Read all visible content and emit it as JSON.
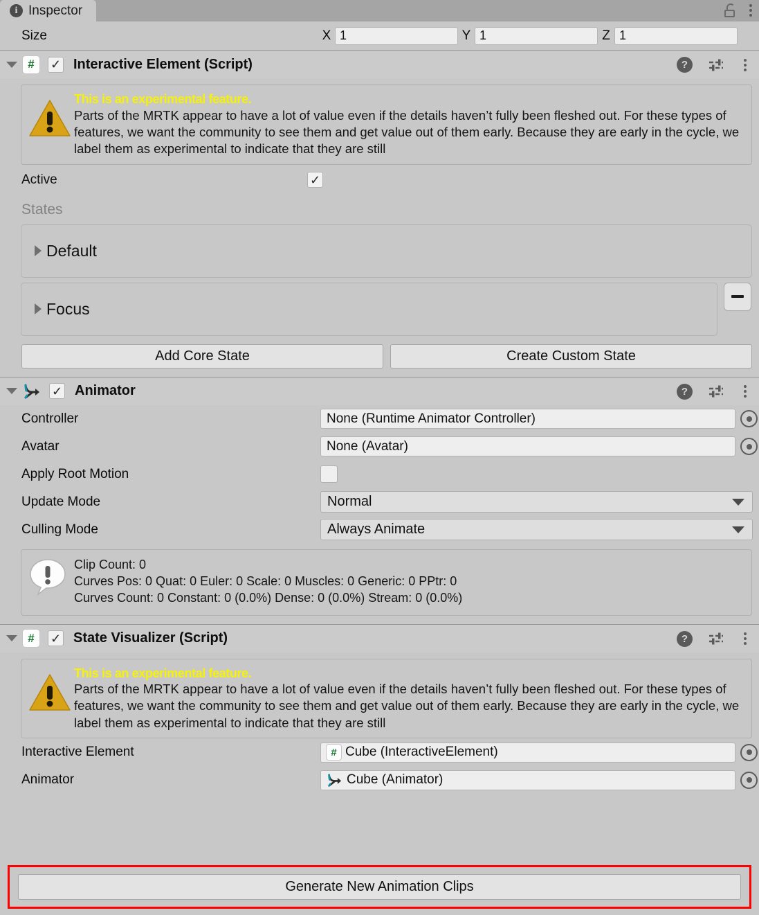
{
  "window": {
    "tab_label": "Inspector",
    "tab_icon": "info-icon",
    "lock_icon": "unlocked-padlock-icon",
    "menu_icon": "kebab-menu-icon"
  },
  "size_row": {
    "label": "Size",
    "axes": [
      {
        "letter": "X",
        "value": "1"
      },
      {
        "letter": "Y",
        "value": "1"
      },
      {
        "letter": "Z",
        "value": "1"
      }
    ]
  },
  "experimental_warning": {
    "title": "This is an experimental feature.",
    "body": "Parts of the MRTK appear to have a lot of value even if the details haven’t fully been fleshed out. For these types of features, we want the community to see them and get value out of them early. Because they are early in the cycle, we label them as experimental to indicate that they are still"
  },
  "interactive_element": {
    "title": "Interactive Element (Script)",
    "icon": "csharp-script-icon",
    "enabled": true,
    "active_label": "Active",
    "active_checked": true,
    "states_label": "States",
    "states": [
      {
        "name": "Default",
        "removable": false
      },
      {
        "name": "Focus",
        "removable": true
      }
    ],
    "add_core_state_label": "Add Core State",
    "create_custom_state_label": "Create Custom State"
  },
  "animator": {
    "title": "Animator",
    "icon": "animator-icon",
    "enabled": true,
    "properties": [
      {
        "name": "Controller",
        "value": "None (Runtime Animator Controller)",
        "type": "object"
      },
      {
        "name": "Avatar",
        "value": "None (Avatar)",
        "type": "object"
      },
      {
        "name": "Apply Root Motion",
        "value": "",
        "type": "checkbox",
        "checked": false
      },
      {
        "name": "Update Mode",
        "value": "Normal",
        "type": "dropdown"
      },
      {
        "name": "Culling Mode",
        "value": "Always Animate",
        "type": "dropdown"
      }
    ],
    "info": {
      "icon": "info-bubble-icon",
      "lines": [
        "Clip Count: 0",
        "Curves Pos: 0 Quat: 0 Euler: 0 Scale: 0 Muscles: 0 Generic: 0 PPtr: 0",
        "Curves Count: 0 Constant: 0 (0.0%) Dense: 0 (0.0%) Stream: 0 (0.0%)"
      ]
    }
  },
  "state_visualizer": {
    "title": "State Visualizer (Script)",
    "icon": "csharp-script-icon",
    "enabled": true,
    "properties": [
      {
        "name": "Interactive Element",
        "value": "Cube (InteractiveElement)",
        "icon": "csharp-script-icon"
      },
      {
        "name": "Animator",
        "value": "Cube (Animator)",
        "icon": "animator-icon"
      }
    ],
    "generate_button_label": "Generate New Animation Clips"
  },
  "header_icons": {
    "help": "help-icon",
    "preset": "preset-sliders-icon",
    "menu": "kebab-menu-icon"
  },
  "colors": {
    "highlight": "#ff0000",
    "warning_title": "#f6f10a",
    "warning_triangle": "#d8a317",
    "script_icon_text": "#1d7a34",
    "animator_icon": "#2b2b2b",
    "background": "#c8c8c8",
    "tabbar": "#a5a5a5"
  }
}
